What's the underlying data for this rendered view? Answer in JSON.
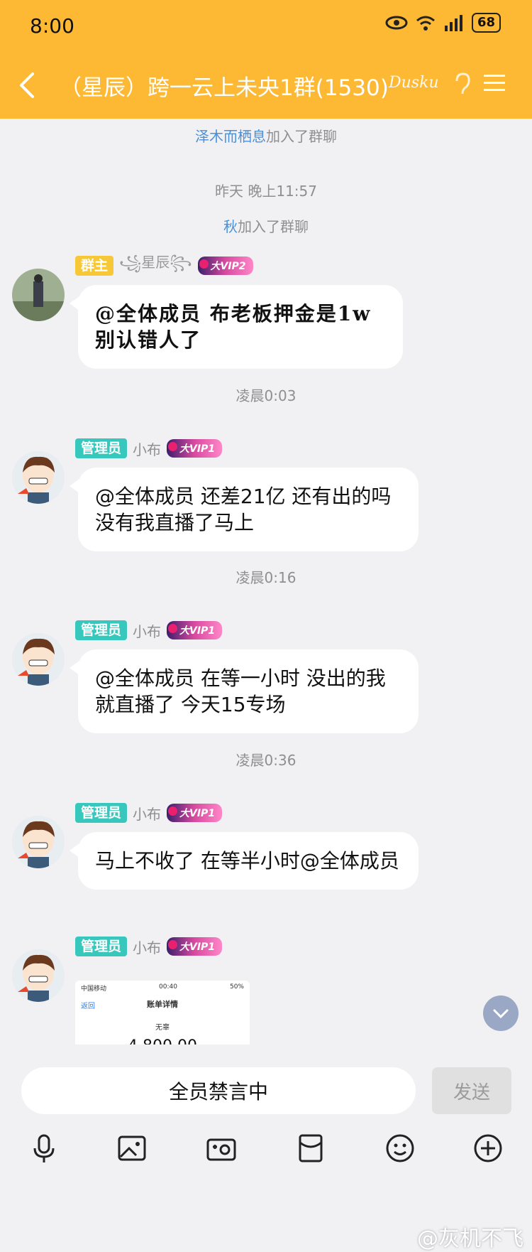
{
  "status": {
    "time": "8:00",
    "battery": "68",
    "network": "4G"
  },
  "header": {
    "title": "（星辰）跨一云上未央1群(1530)",
    "logo_text": "Dusku"
  },
  "system_msgs": [
    {
      "name": "泽木而栖息",
      "text": "加入了群聊"
    },
    {
      "name": "秋",
      "text": "加入了群聊"
    }
  ],
  "timestamps": [
    "昨天 晚上11:57",
    "凌晨0:03",
    "凌晨0:16",
    "凌晨0:36"
  ],
  "messages": [
    {
      "badge": "群主",
      "nick": "꧁星辰꧂",
      "vip": "大VIP2",
      "text": "@全体成员 布老板押金是1w 别认错人了"
    },
    {
      "badge": "管理员",
      "nick": "小布",
      "vip": "大VIP1",
      "text": "@全体成员 还差21亿 还有出的吗 没有我直播了马上"
    },
    {
      "badge": "管理员",
      "nick": "小布",
      "vip": "大VIP1",
      "text": "@全体成员 在等一小时 没出的我就直播了 今天15专场"
    },
    {
      "badge": "管理员",
      "nick": "小布",
      "vip": "大VIP1",
      "text": "马上不收了 在等半小时@全体成员"
    },
    {
      "badge": "管理员",
      "nick": "小布",
      "vip": "大VIP1"
    }
  ],
  "image_msg": {
    "carrier": "中国移动",
    "time": "00:40",
    "battery": "50%",
    "back": "返回",
    "title": "账单详情",
    "who": "无辜",
    "amount": "4,800.00"
  },
  "input": {
    "muted_text": "全员禁言中",
    "send_label": "发送"
  },
  "watermark": "@灰机不飞"
}
